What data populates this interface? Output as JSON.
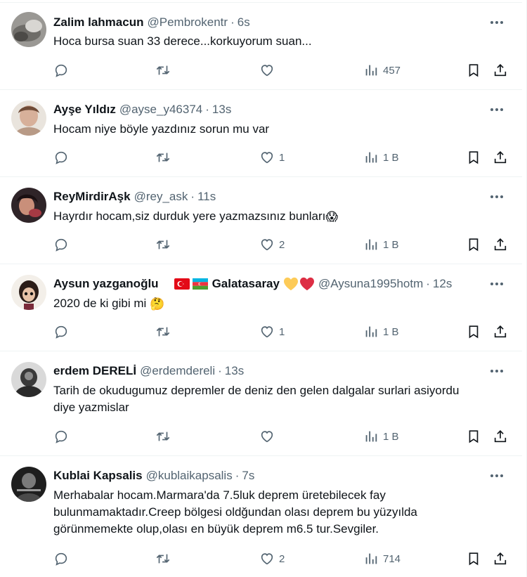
{
  "tweets": [
    {
      "name": "Zalim lahmacun",
      "handle": "@Pembrokentr",
      "time": "6s",
      "text": "Hoca bursa suan 33 derece...korkuyorum suan...",
      "replies": "",
      "retweets": "",
      "likes": "",
      "views": "457",
      "avatar_color": "#8a8a86"
    },
    {
      "name": "Ayşe Yıldız",
      "handle": "@ayse_y46374",
      "time": "13s",
      "text": "Hocam niye böyle yazdınız sorun mu var",
      "replies": "",
      "retweets": "",
      "likes": "1",
      "views": "1 B",
      "avatar_color": "#c9a48c"
    },
    {
      "name": "ReyMirdirAşk",
      "handle": "@rey_ask",
      "time": "11s",
      "text": "Hayrdır hocam,siz durduk yere yazmazsınız bunları",
      "emoji": "😱",
      "replies": "",
      "retweets": "",
      "likes": "2",
      "views": "1 B",
      "avatar_color": "#3a2a2e"
    },
    {
      "name": "Aysun yazganoğlu",
      "name_extra": "Galatasaray",
      "handle": "@Aysuna1995hotm",
      "time": "12s",
      "text": "2020 de ki gibi mi",
      "emoji": "🤔",
      "replies": "",
      "retweets": "",
      "likes": "1",
      "views": "1 B",
      "avatar_color": "#2b1d18"
    },
    {
      "name": "erdem DERELİ",
      "handle": "@erdemdereli",
      "time": "13s",
      "text": "Tarih de okudugumuz depremler de deniz den gelen dalgalar surlari asiyordu diye yazmislar",
      "replies": "",
      "retweets": "",
      "likes": "",
      "views": "1 B",
      "avatar_color": "#5b5b5b"
    },
    {
      "name": "Kublai Kapsalis",
      "handle": "@kublaikapsalis",
      "time": "7s",
      "text": "Merhabalar hocam.Marmara'da 7.5luk deprem üretebilecek fay bulunmamaktadır.Creep bölgesi oldğundan olası deprem bu yüzyılda görünmemekte olup,olası en büyük deprem m6.5 tur.Sevgiler.",
      "replies": "",
      "retweets": "",
      "likes": "2",
      "views": "714",
      "avatar_color": "#2a2a2a"
    }
  ],
  "icons": {
    "reply": "reply-icon",
    "retweet": "retweet-icon",
    "like": "like-icon",
    "views": "views-icon",
    "bookmark": "bookmark-icon",
    "share": "share-icon",
    "more": "more-icon"
  },
  "colors": {
    "text": "#0f1419",
    "secondary": "#536471",
    "divider": "#eff3f4"
  }
}
